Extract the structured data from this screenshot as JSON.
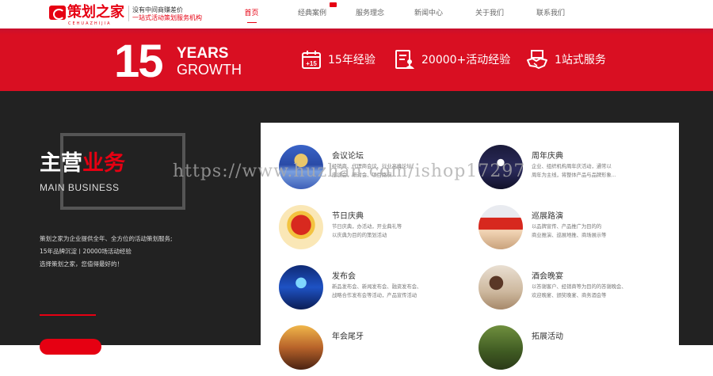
{
  "header": {
    "logo_name": "策划之家",
    "logo_pinyin": "CEHUAZHIJIA",
    "tagline_1": "没有中间商赚差价",
    "tagline_2": "一站式活动策划服务机构",
    "nav": [
      {
        "label": "首页",
        "active": true
      },
      {
        "label": "经典案例",
        "active": false,
        "hot": true
      },
      {
        "label": "服务理念",
        "active": false
      },
      {
        "label": "新闻中心",
        "active": false
      },
      {
        "label": "关于我们",
        "active": false
      },
      {
        "label": "联系我们",
        "active": false
      }
    ]
  },
  "banner": {
    "number": "15",
    "years": "YEARS",
    "growth": "GROWTH",
    "stats": [
      {
        "icon": "calendar-plus-icon",
        "label": "15年经验"
      },
      {
        "icon": "profile-document-icon",
        "label": "20000+活动经验"
      },
      {
        "icon": "handshake-icon",
        "label": "1站式服务"
      }
    ]
  },
  "main": {
    "title_white": "主营",
    "title_red": "业务",
    "subtitle": "MAIN BUSINESS",
    "intro": [
      "策划之家为企业提供全年、全方位的活动策划服务;",
      "15年品牌沉淀丨20000场活动经验",
      "选择策划之家，您值得最好的！"
    ]
  },
  "services": [
    {
      "title": "会议论坛",
      "desc": [
        "经销商、代理商会议、行业高峰论坛、",
        "座谈会、研讨会、项目路演..."
      ]
    },
    {
      "title": "周年庆典",
      "desc": [
        "企业、组织机构周年庆活动，通常以",
        "周年为主线，将整体产品与品牌形象..."
      ]
    },
    {
      "title": "节日庆典",
      "desc": [
        "节日庆典，办活动，开业典礼等",
        "以庆典为目的的策划活动"
      ]
    },
    {
      "title": "巡展路演",
      "desc": [
        "以品牌宣传、产品推广为目的的",
        "商业推演、巡展地推、商场展示等"
      ]
    },
    {
      "title": "发布会",
      "desc": [
        "新品发布会、新闻发布会、融资发布会、",
        "战略合作发布会等活动，产品宣传活动"
      ]
    },
    {
      "title": "酒会晚宴",
      "desc": [
        "以答谢客户、经销商等为目的的答谢晚会、",
        "欢迎晚宴、颁奖晚宴、商务酒会等"
      ]
    },
    {
      "title": "年会尾牙",
      "desc": [
        "",
        ""
      ]
    },
    {
      "title": "拓展活动",
      "desc": [
        "",
        ""
      ]
    }
  ],
  "watermark": "https://www.huzhan.com/ishop17297",
  "colors": {
    "brand_red": "#e60012",
    "strip_red": "#d90f22",
    "dark_bg": "#222222"
  }
}
